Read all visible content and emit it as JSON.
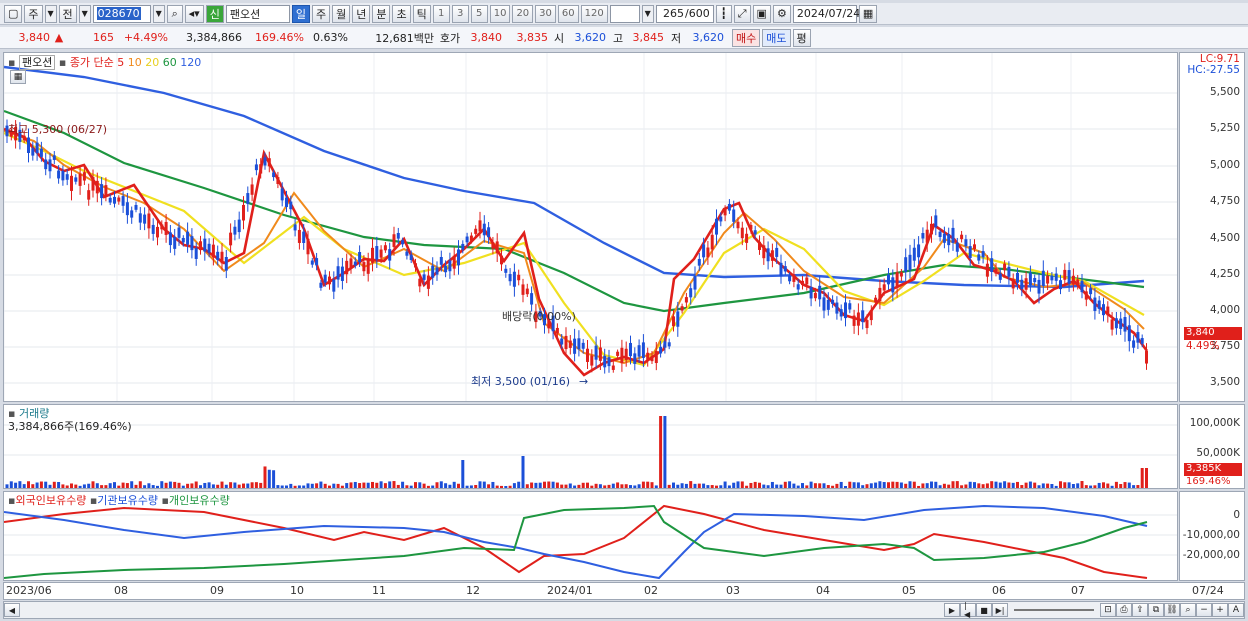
{
  "toolbar": {
    "mode_label": "주",
    "prev_label": "전",
    "code": "028670",
    "flag": "신",
    "name": "팬오션",
    "periods": [
      "일",
      "주",
      "월",
      "년",
      "분",
      "초",
      "틱"
    ],
    "active_period": "일",
    "nums": [
      "1",
      "3",
      "5",
      "10",
      "20",
      "30",
      "60",
      "120"
    ],
    "count": "265",
    "count_max": "/600",
    "date": "2024/07/24"
  },
  "quote": {
    "price": "3,840",
    "arrow": "▲",
    "change": "165",
    "change_pct": "+4.49%",
    "volume": "3,384,866",
    "vol_pct": "169.46%",
    "turnover": "0.63%",
    "amount": "12,681백만",
    "hoga_label": "호가",
    "ask": "3,840",
    "bid": "3,835",
    "open_label": "시",
    "open": "3,620",
    "high_label": "고",
    "high": "3,845",
    "low_label": "저",
    "low": "3,620",
    "buy": "매수",
    "sell": "매도",
    "flat": "평"
  },
  "price_panel": {
    "stock": "팬오션",
    "ma_title": "종가 단순",
    "ma_periods": [
      "5",
      "10",
      "20",
      "60",
      "120"
    ],
    "ma_colors": [
      "#e0201b",
      "#f08a1c",
      "#f0e020",
      "#1e9640",
      "#2f5fe0"
    ],
    "high_note": "최고 5,300 (06/27)",
    "low_note": "최저 3,500 (01/16)",
    "div_note": "배당락(0.00%)",
    "lc": "LC:9.71",
    "hc": "HC:-27.55",
    "y_ticks": [
      "5,500",
      "5,250",
      "5,000",
      "4,750",
      "4,500",
      "4,250",
      "4,000",
      "3,750",
      "3,500"
    ],
    "last_price_tag": "3,840",
    "last_pct_tag": "4.49%"
  },
  "volume_panel": {
    "title": "거래량",
    "value": "3,384,866주(169.46%)",
    "y_ticks": [
      "100,000K",
      "50,000K"
    ],
    "last_tag": "3,385K",
    "last_pct": "169.46%"
  },
  "holding_panel": {
    "legend": [
      "외국인보유수량",
      "기관보유수량",
      "개인보유수량"
    ],
    "colors": [
      "#e0201b",
      "#2f5fe0",
      "#1e9640"
    ],
    "y_ticks": [
      "0",
      "-10,000,00",
      "-20,000,00"
    ]
  },
  "x_axis": [
    "2023/06",
    "08",
    "09",
    "10",
    "11",
    "12",
    "2024/01",
    "02",
    "03",
    "04",
    "05",
    "06",
    "07",
    "07/24"
  ]
}
